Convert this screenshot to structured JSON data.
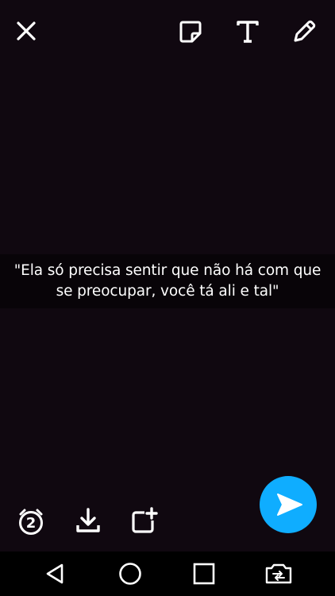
{
  "top_bar": {
    "close_icon": "close-icon",
    "sticker_icon": "sticker-icon",
    "text_icon": "text-icon",
    "pencil_icon": "pencil-icon"
  },
  "caption": {
    "text": "\"Ela só precisa sentir que não há com que se preocupar, você tá ali e tal\""
  },
  "bottom_tools": {
    "timer_value": "2",
    "save_icon": "download-icon",
    "add_story_icon": "add-story-icon",
    "send_icon": "send-arrow-icon"
  },
  "nav_bar": {
    "back_icon": "back-triangle-icon",
    "home_icon": "home-circle-icon",
    "recents_icon": "recents-square-icon",
    "camera_icon": "camera-switch-icon"
  },
  "colors": {
    "background": "#100810",
    "send_button": "#0fadff",
    "icon": "#ffffff"
  }
}
